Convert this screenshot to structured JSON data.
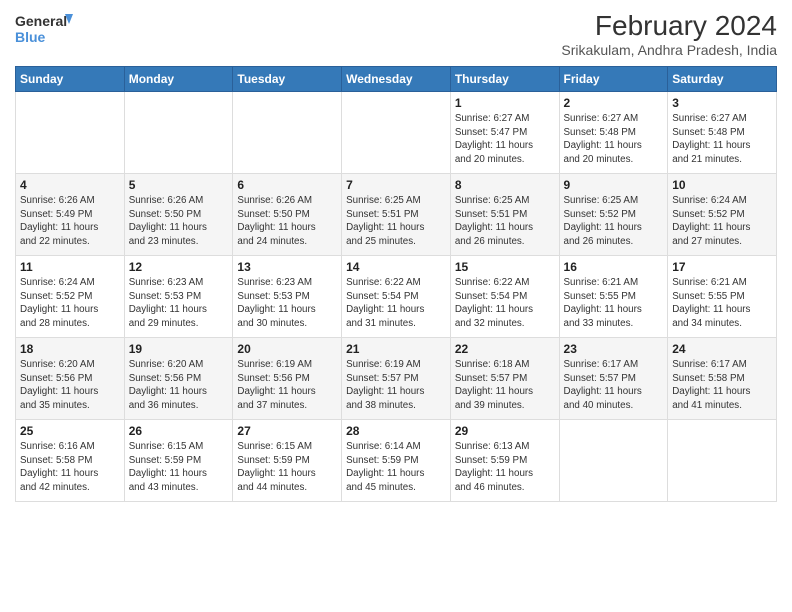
{
  "header": {
    "logo_line1": "General",
    "logo_line2": "Blue",
    "title": "February 2024",
    "subtitle": "Srikakulam, Andhra Pradesh, India"
  },
  "weekdays": [
    "Sunday",
    "Monday",
    "Tuesday",
    "Wednesday",
    "Thursday",
    "Friday",
    "Saturday"
  ],
  "weeks": [
    [
      {
        "day": "",
        "info": ""
      },
      {
        "day": "",
        "info": ""
      },
      {
        "day": "",
        "info": ""
      },
      {
        "day": "",
        "info": ""
      },
      {
        "day": "1",
        "info": "Sunrise: 6:27 AM\nSunset: 5:47 PM\nDaylight: 11 hours\nand 20 minutes."
      },
      {
        "day": "2",
        "info": "Sunrise: 6:27 AM\nSunset: 5:48 PM\nDaylight: 11 hours\nand 20 minutes."
      },
      {
        "day": "3",
        "info": "Sunrise: 6:27 AM\nSunset: 5:48 PM\nDaylight: 11 hours\nand 21 minutes."
      }
    ],
    [
      {
        "day": "4",
        "info": "Sunrise: 6:26 AM\nSunset: 5:49 PM\nDaylight: 11 hours\nand 22 minutes."
      },
      {
        "day": "5",
        "info": "Sunrise: 6:26 AM\nSunset: 5:50 PM\nDaylight: 11 hours\nand 23 minutes."
      },
      {
        "day": "6",
        "info": "Sunrise: 6:26 AM\nSunset: 5:50 PM\nDaylight: 11 hours\nand 24 minutes."
      },
      {
        "day": "7",
        "info": "Sunrise: 6:25 AM\nSunset: 5:51 PM\nDaylight: 11 hours\nand 25 minutes."
      },
      {
        "day": "8",
        "info": "Sunrise: 6:25 AM\nSunset: 5:51 PM\nDaylight: 11 hours\nand 26 minutes."
      },
      {
        "day": "9",
        "info": "Sunrise: 6:25 AM\nSunset: 5:52 PM\nDaylight: 11 hours\nand 26 minutes."
      },
      {
        "day": "10",
        "info": "Sunrise: 6:24 AM\nSunset: 5:52 PM\nDaylight: 11 hours\nand 27 minutes."
      }
    ],
    [
      {
        "day": "11",
        "info": "Sunrise: 6:24 AM\nSunset: 5:52 PM\nDaylight: 11 hours\nand 28 minutes."
      },
      {
        "day": "12",
        "info": "Sunrise: 6:23 AM\nSunset: 5:53 PM\nDaylight: 11 hours\nand 29 minutes."
      },
      {
        "day": "13",
        "info": "Sunrise: 6:23 AM\nSunset: 5:53 PM\nDaylight: 11 hours\nand 30 minutes."
      },
      {
        "day": "14",
        "info": "Sunrise: 6:22 AM\nSunset: 5:54 PM\nDaylight: 11 hours\nand 31 minutes."
      },
      {
        "day": "15",
        "info": "Sunrise: 6:22 AM\nSunset: 5:54 PM\nDaylight: 11 hours\nand 32 minutes."
      },
      {
        "day": "16",
        "info": "Sunrise: 6:21 AM\nSunset: 5:55 PM\nDaylight: 11 hours\nand 33 minutes."
      },
      {
        "day": "17",
        "info": "Sunrise: 6:21 AM\nSunset: 5:55 PM\nDaylight: 11 hours\nand 34 minutes."
      }
    ],
    [
      {
        "day": "18",
        "info": "Sunrise: 6:20 AM\nSunset: 5:56 PM\nDaylight: 11 hours\nand 35 minutes."
      },
      {
        "day": "19",
        "info": "Sunrise: 6:20 AM\nSunset: 5:56 PM\nDaylight: 11 hours\nand 36 minutes."
      },
      {
        "day": "20",
        "info": "Sunrise: 6:19 AM\nSunset: 5:56 PM\nDaylight: 11 hours\nand 37 minutes."
      },
      {
        "day": "21",
        "info": "Sunrise: 6:19 AM\nSunset: 5:57 PM\nDaylight: 11 hours\nand 38 minutes."
      },
      {
        "day": "22",
        "info": "Sunrise: 6:18 AM\nSunset: 5:57 PM\nDaylight: 11 hours\nand 39 minutes."
      },
      {
        "day": "23",
        "info": "Sunrise: 6:17 AM\nSunset: 5:57 PM\nDaylight: 11 hours\nand 40 minutes."
      },
      {
        "day": "24",
        "info": "Sunrise: 6:17 AM\nSunset: 5:58 PM\nDaylight: 11 hours\nand 41 minutes."
      }
    ],
    [
      {
        "day": "25",
        "info": "Sunrise: 6:16 AM\nSunset: 5:58 PM\nDaylight: 11 hours\nand 42 minutes."
      },
      {
        "day": "26",
        "info": "Sunrise: 6:15 AM\nSunset: 5:59 PM\nDaylight: 11 hours\nand 43 minutes."
      },
      {
        "day": "27",
        "info": "Sunrise: 6:15 AM\nSunset: 5:59 PM\nDaylight: 11 hours\nand 44 minutes."
      },
      {
        "day": "28",
        "info": "Sunrise: 6:14 AM\nSunset: 5:59 PM\nDaylight: 11 hours\nand 45 minutes."
      },
      {
        "day": "29",
        "info": "Sunrise: 6:13 AM\nSunset: 5:59 PM\nDaylight: 11 hours\nand 46 minutes."
      },
      {
        "day": "",
        "info": ""
      },
      {
        "day": "",
        "info": ""
      }
    ]
  ]
}
